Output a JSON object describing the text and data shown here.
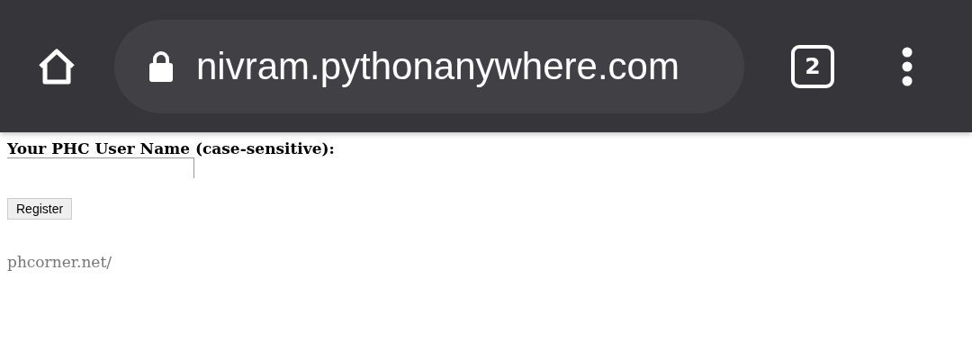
{
  "toolbar": {
    "url": "nivram.pythonanywhere.com",
    "tab_count": "2"
  },
  "form": {
    "label": "Your PHC User Name (case-sensitive):",
    "button": "Register"
  },
  "footer_text": "phcorner.net/"
}
